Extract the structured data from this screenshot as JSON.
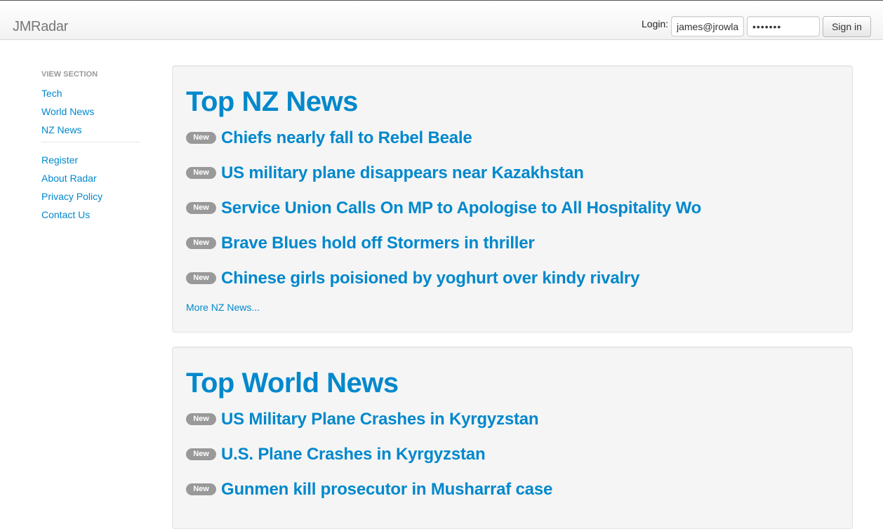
{
  "navbar": {
    "brand": "JMRadar",
    "login_label": "Login:",
    "email_value": "james@jrowlar",
    "password_value": "•••••••",
    "signin_label": "Sign in"
  },
  "sidebar": {
    "header": "View Section",
    "sections": [
      {
        "label": "Tech"
      },
      {
        "label": "World News"
      },
      {
        "label": "NZ News"
      }
    ],
    "links": [
      {
        "label": "Register"
      },
      {
        "label": "About Radar"
      },
      {
        "label": "Privacy Policy"
      },
      {
        "label": "Contact Us"
      }
    ]
  },
  "nz_news": {
    "title": "Top NZ News",
    "badge": "New",
    "stories": [
      {
        "title": "Chiefs nearly fall to Rebel Beale"
      },
      {
        "title": "US military plane disappears near Kazakhstan"
      },
      {
        "title": "Service Union Calls On MP to Apologise to All Hospitality Wo"
      },
      {
        "title": "Brave Blues hold off Stormers in thriller"
      },
      {
        "title": "Chinese girls poisioned by yoghurt over kindy rivalry"
      }
    ],
    "more_label": "More NZ News..."
  },
  "world_news": {
    "title": "Top World News",
    "badge": "New",
    "stories": [
      {
        "title": "US Military Plane Crashes in Kyrgyzstan"
      },
      {
        "title": "U.S. Plane Crashes in Kyrgyzstan"
      },
      {
        "title": "Gunmen kill prosecutor in Musharraf case"
      }
    ]
  }
}
